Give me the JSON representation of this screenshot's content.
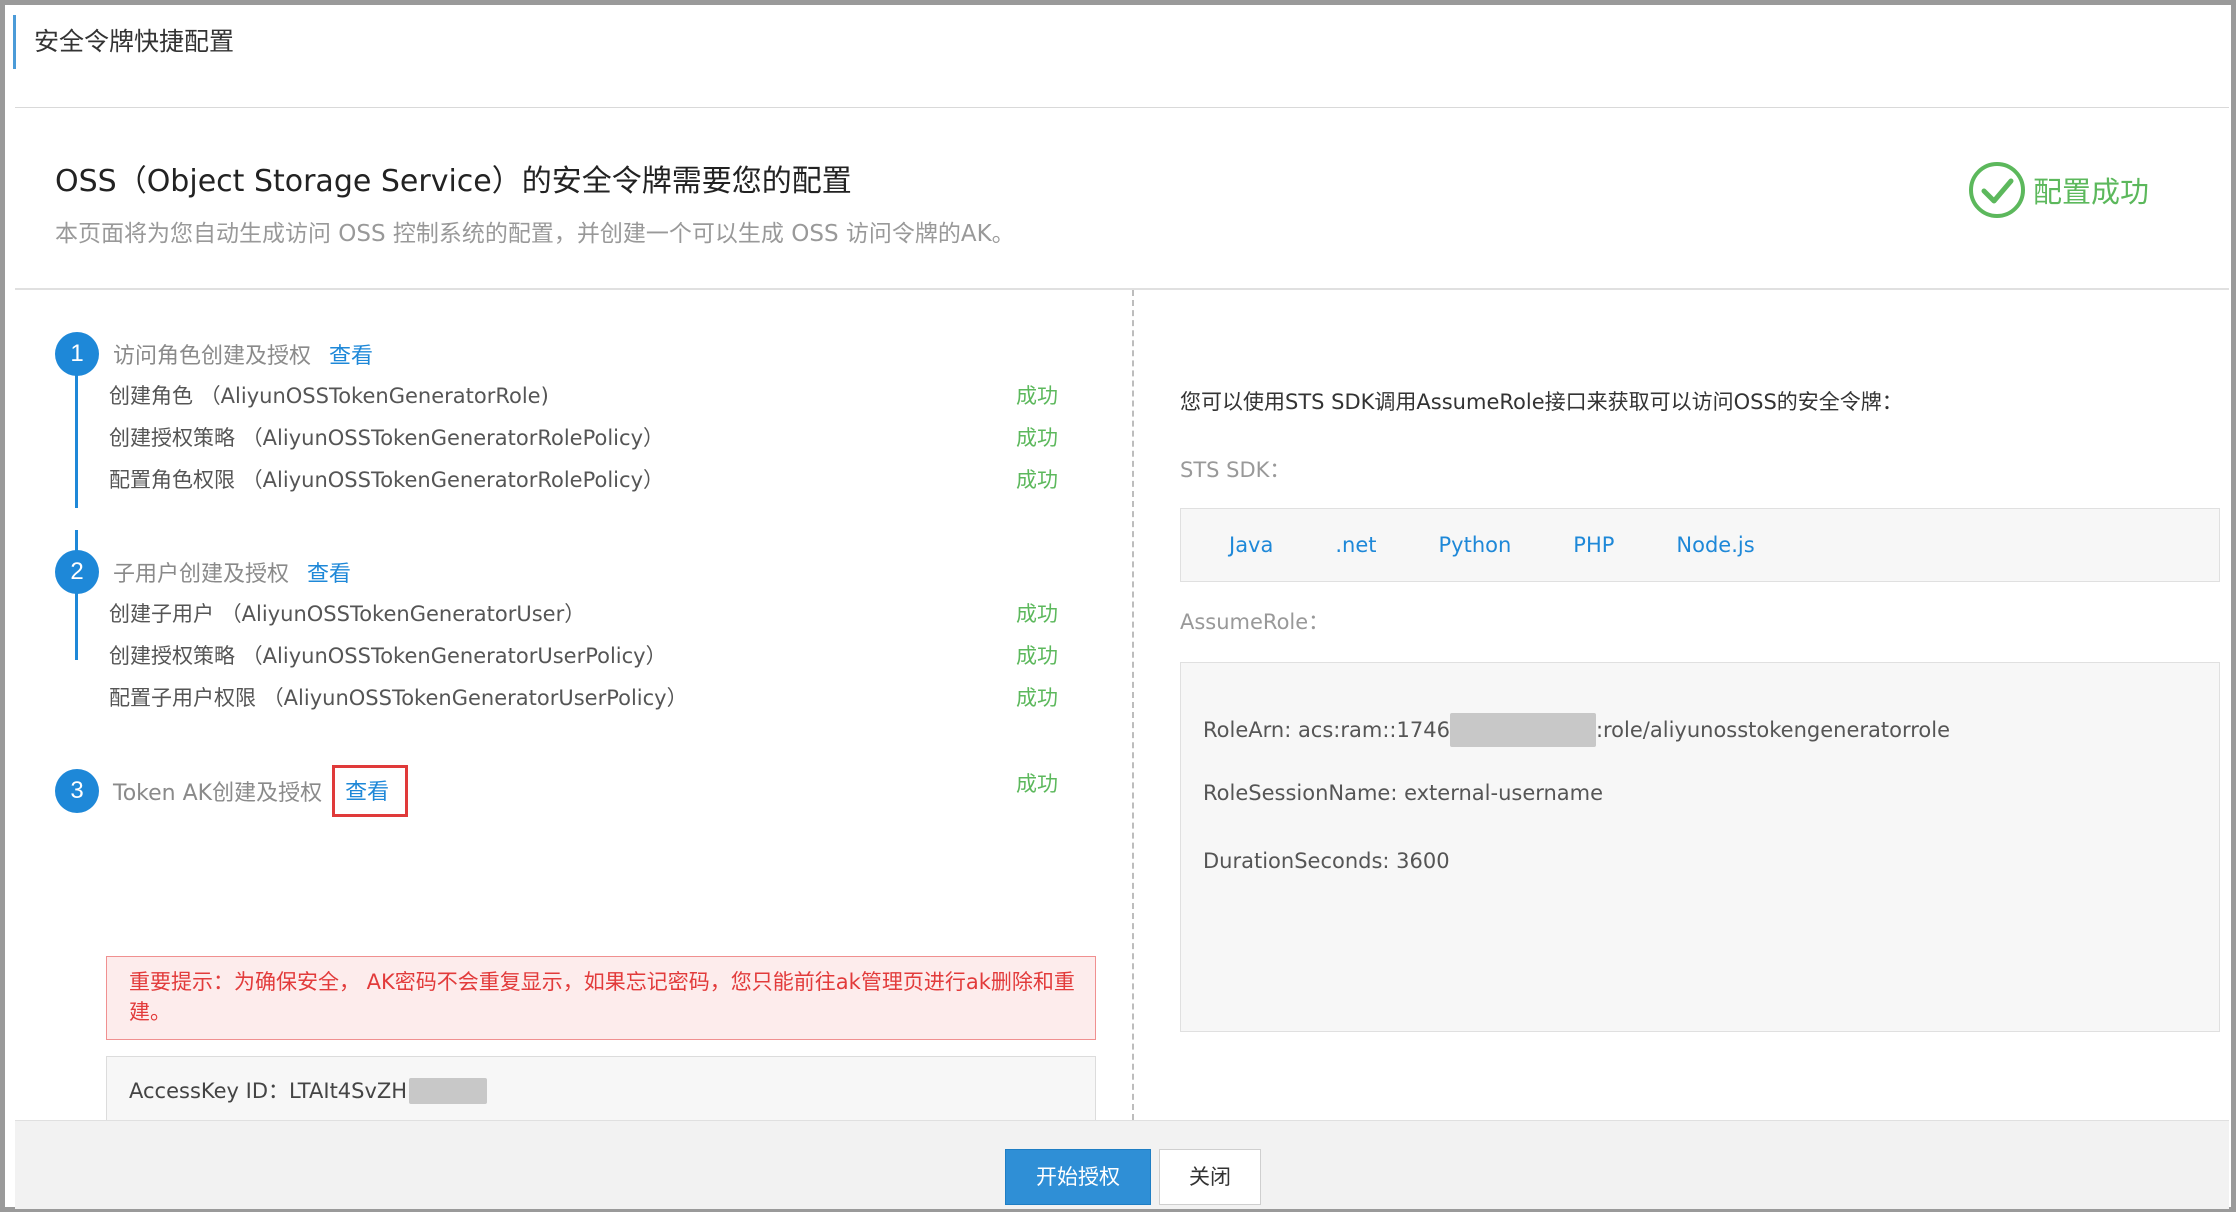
{
  "page_title": "安全令牌快捷配置",
  "header": {
    "title": "OSS（Object Storage Service）的安全令牌需要您的配置",
    "subtitle": "本页面将为您自动生成访问 OSS 控制系统的配置，并创建一个可以生成 OSS 访问令牌的AK。",
    "status": "配置成功"
  },
  "colors": {
    "accent": "#1e88d8",
    "success": "#5cb85c",
    "warning": "#e23b3b"
  },
  "steps": [
    {
      "number": "1",
      "label": "访问角色创建及授权",
      "link": "查看",
      "items": [
        {
          "text": "创建角色 （AliyunOSSTokenGeneratorRole)",
          "status": "成功"
        },
        {
          "text": "创建授权策略 （AliyunOSSTokenGeneratorRolePolicy）",
          "status": "成功"
        },
        {
          "text": "配置角色权限 （AliyunOSSTokenGeneratorRolePolicy）",
          "status": "成功"
        }
      ]
    },
    {
      "number": "2",
      "label": "子用户创建及授权",
      "link": "查看",
      "items": [
        {
          "text": "创建子用户 （AliyunOSSTokenGeneratorUser）",
          "status": "成功"
        },
        {
          "text": "创建授权策略 （AliyunOSSTokenGeneratorUserPolicy）",
          "status": "成功"
        },
        {
          "text": "配置子用户权限 （AliyunOSSTokenGeneratorUserPolicy）",
          "status": "成功"
        }
      ]
    },
    {
      "number": "3",
      "label": "Token AK创建及授权",
      "link": "查看",
      "status": "成功"
    }
  ],
  "warning": "重要提示：为确保安全， AK密码不会重复显示，如果忘记密码，您只能前往ak管理页进行ak删除和重建。",
  "access_key": {
    "label": "AccessKey ID：LTAIt4SvZH"
  },
  "right": {
    "intro": "您可以使用STS SDK调用AssumeRole接口来获取可以访问OSS的安全令牌：",
    "sdk_label": "STS SDK：",
    "sdks": [
      "Java",
      ".net",
      "Python",
      "PHP",
      "Node.js"
    ],
    "assume_label": "AssumeRole：",
    "role_arn_prefix": "RoleArn: acs:ram::1746",
    "role_arn_suffix": ":role/aliyunosstokengeneratorrole",
    "session_name": "RoleSessionName: external-username",
    "duration": "DurationSeconds: 3600"
  },
  "footer": {
    "primary": "开始授权",
    "close": "关闭"
  }
}
